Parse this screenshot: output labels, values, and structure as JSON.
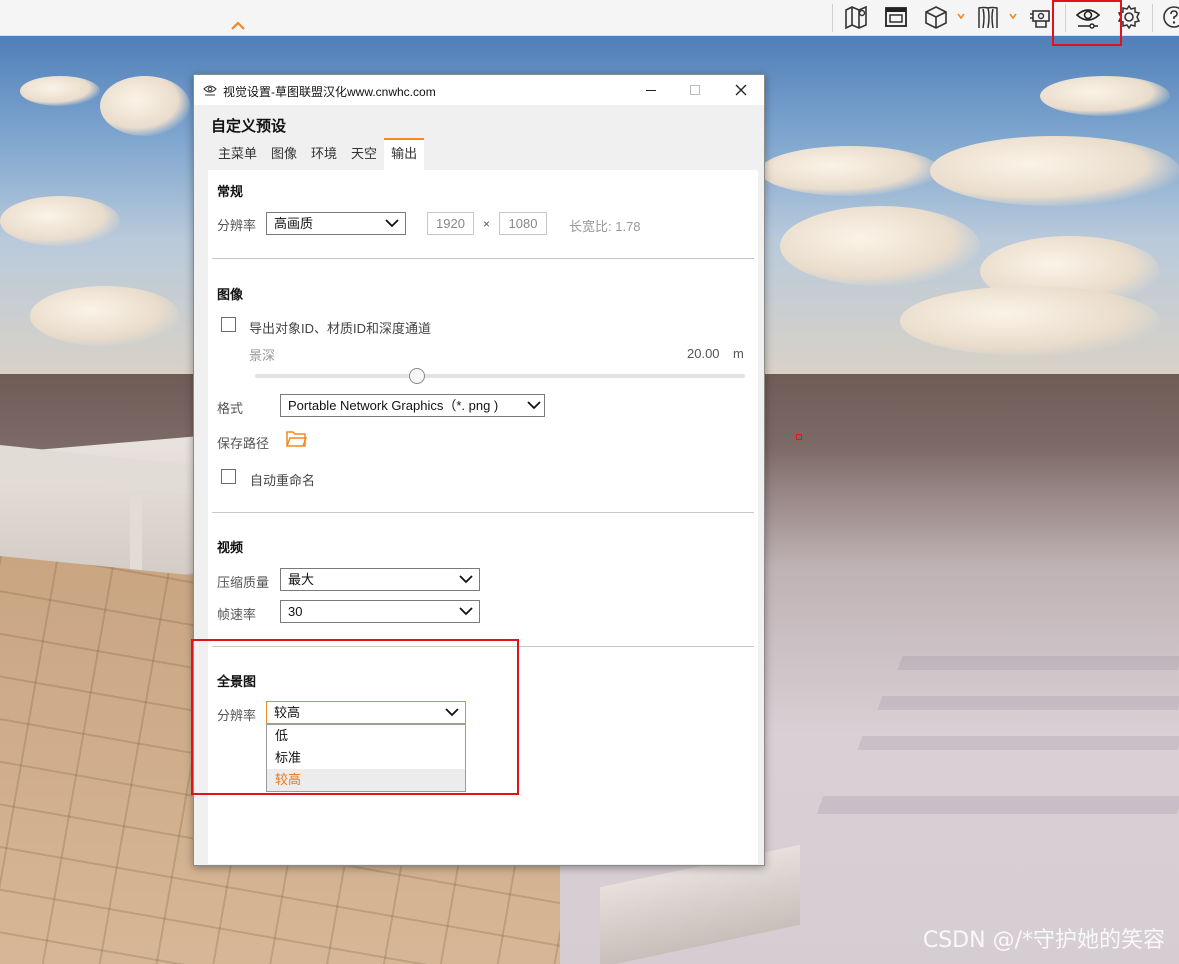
{
  "toolbar": {
    "icons": [
      "map-icon",
      "layout-icon",
      "cube-icon",
      "curtain-icon",
      "camera-print-icon",
      "visibility-eye-icon",
      "gear-icon",
      "help-icon"
    ]
  },
  "dialog": {
    "title": "视觉设置-草图联盟汉化www.cnwhc.com",
    "preset_name": "自定义预设",
    "tabs": [
      {
        "label": "主菜单"
      },
      {
        "label": "图像"
      },
      {
        "label": "环境"
      },
      {
        "label": "天空"
      },
      {
        "label": "输出",
        "active": true
      }
    ],
    "general": {
      "title": "常规",
      "resolution_label": "分辨率",
      "resolution_value": "高画质",
      "width": "1920",
      "times": "×",
      "height": "1080",
      "aspect": "长宽比: 1.78"
    },
    "image": {
      "title": "图像",
      "export_ids_label": "导出对象ID、材质ID和深度通道",
      "depth_label": "景深",
      "depth_value": "20.00",
      "depth_unit": "m",
      "depth_slider_fraction": 0.33,
      "format_label": "格式",
      "format_value": "Portable Network Graphics（*. png )",
      "save_path_label": "保存路径",
      "auto_rename_label": "自动重命名"
    },
    "video": {
      "title": "视频",
      "quality_label": "压缩质量",
      "quality_value": "最大",
      "fps_label": "帧速率",
      "fps_value": "30"
    },
    "panorama": {
      "title": "全景图",
      "resolution_label": "分辨率",
      "resolution_value": "较高",
      "options": [
        "低",
        "标准",
        "较高"
      ],
      "selected_index": 2
    }
  },
  "watermark": "CSDN @/*守护她的笑容",
  "colors": {
    "accent": "#f08a24",
    "highlight_red": "#e0121a"
  }
}
